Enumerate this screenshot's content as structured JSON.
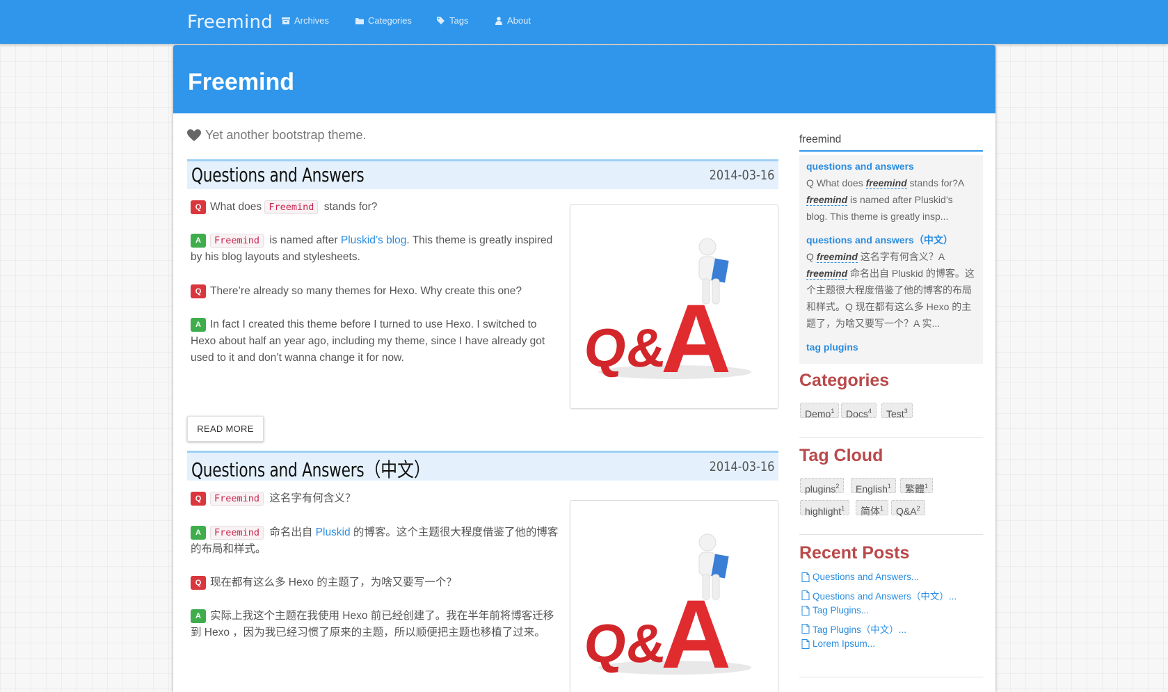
{
  "nav": {
    "brand": "Freemind",
    "items": [
      {
        "label": "Archives",
        "icon": "archive-icon"
      },
      {
        "label": "Categories",
        "icon": "folder-icon"
      },
      {
        "label": "Tags",
        "icon": "tags-icon"
      },
      {
        "label": "About",
        "icon": "user-icon"
      }
    ]
  },
  "header": {
    "title": "Freemind",
    "tagline": "Yet another bootstrap theme."
  },
  "posts": [
    {
      "title": "Questions and Answers",
      "date": "2014-03-16",
      "lines": [
        {
          "badge": "Q",
          "pre": "What does ",
          "code": "Freemind",
          "mid": " stands for?",
          "link": "",
          "post": ""
        },
        {
          "badge": "A",
          "pre": "",
          "code": "Freemind",
          "mid": " is named after ",
          "link": "Pluskid’s blog",
          "post": ". This theme is greatly inspired by his blog layouts and stylesheets."
        },
        {
          "badge": "Q",
          "pre": "There’re already so many themes for Hexo. Why create this one?",
          "code": "",
          "mid": "",
          "link": "",
          "post": ""
        },
        {
          "badge": "A",
          "pre": "In fact I created this theme before I turned to use Hexo. I switched to Hexo about half an year ago, including my theme, since I have already got used to it and don’t wanna change it for now.",
          "code": "",
          "mid": "",
          "link": "",
          "post": ""
        }
      ],
      "thumb_alt": "Q&A"
    },
    {
      "title": "Questions and Answers（中文）",
      "date": "2014-03-16",
      "lines": [
        {
          "badge": "Q",
          "pre": "",
          "code": "Freemind",
          "mid": " 这名字有何含义？",
          "link": "",
          "post": ""
        },
        {
          "badge": "A",
          "pre": "",
          "code": "Freemind",
          "mid": " 命名出自 ",
          "link": "Pluskid",
          "post": " 的博客。这个主题很大程度借鉴了他的博客的布局和样式。"
        },
        {
          "badge": "Q",
          "pre": "现在都有这么多 Hexo 的主题了，为啥又要写一个？",
          "code": "",
          "mid": "",
          "link": "",
          "post": ""
        },
        {
          "badge": "A",
          "pre": "实际上我这个主题在我使用 Hexo 前已经创建了。我在半年前将博客迁移到 Hexo ，因为我已经习惯了原来的主题，所以顺便把主题也移植了过来。",
          "code": "",
          "mid": "",
          "link": "",
          "post": ""
        }
      ],
      "thumb_alt": "Q&A"
    }
  ],
  "read_more": "READ MORE",
  "sidebar": {
    "search_value": "freemind",
    "results": [
      {
        "title": "questions and answers",
        "text_parts": [
          "Q What does ",
          "freemind",
          " stands for?A ",
          "freemind",
          " is named after Pluskid’s blog. This theme is greatly insp..."
        ]
      },
      {
        "title": "questions and answers（中文）",
        "text_parts": [
          "Q ",
          "freemind",
          " 这名字有何含义？A ",
          "freemind",
          " 命名出自 Pluskid 的博客。这个主题很大程度借鉴了他的博客的布局和样式。Q 现在都有这么多 Hexo 的主题了，为啥又要写一个？A 实..."
        ]
      },
      {
        "title": "tag plugins",
        "text_parts": [
          "",
          "",
          "",
          "",
          ""
        ]
      }
    ],
    "categories_heading": "Categories",
    "categories": [
      {
        "name": "Demo",
        "count": "1"
      },
      {
        "name": "Docs",
        "count": "4"
      },
      {
        "name": "Test",
        "count": "3"
      }
    ],
    "tagcloud_heading": "Tag Cloud",
    "tags": [
      {
        "name": "plugins",
        "count": "2"
      },
      {
        "name": "English",
        "count": "1"
      },
      {
        "name": "繁體",
        "count": "1"
      },
      {
        "name": "highlight",
        "count": "1"
      },
      {
        "name": "简体",
        "count": "1"
      },
      {
        "name": "Q&A",
        "count": "2"
      }
    ],
    "recent_heading": "Recent Posts",
    "recent": [
      "Questions and Answers...",
      "Questions and Answers（中文）...",
      "Tag Plugins...",
      "Tag Plugins（中文）...",
      "Lorem Ipsum..."
    ]
  },
  "colors": {
    "primary": "#2f96eb",
    "heading_red": "#b9494a",
    "link": "#2a8de0",
    "q_badge": "#d9363e",
    "a_badge": "#40ad4d"
  }
}
